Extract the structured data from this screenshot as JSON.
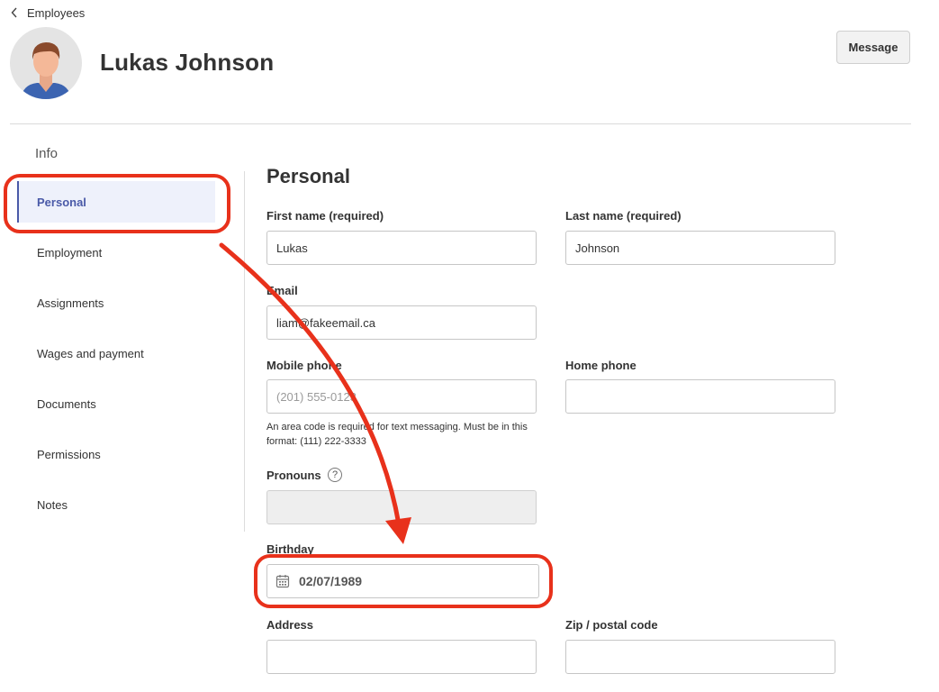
{
  "header": {
    "back_label": "Employees",
    "employee_name": "Lukas Johnson",
    "message_button": "Message"
  },
  "sidebar": {
    "heading": "Info",
    "items": [
      {
        "label": "Personal",
        "active": true
      },
      {
        "label": "Employment"
      },
      {
        "label": "Assignments"
      },
      {
        "label": "Wages and payment"
      },
      {
        "label": "Documents"
      },
      {
        "label": "Permissions"
      },
      {
        "label": "Notes"
      }
    ]
  },
  "form": {
    "section_title": "Personal",
    "first_name": {
      "label": "First name (required)",
      "value": "Lukas"
    },
    "last_name": {
      "label": "Last name (required)",
      "value": "Johnson"
    },
    "email": {
      "label": "Email",
      "value": "liam@fakeemail.ca"
    },
    "mobile_phone": {
      "label": "Mobile phone",
      "placeholder": "(201) 555-0123",
      "helper": "An area code is required for text messaging. Must be in this format: (111) 222-3333"
    },
    "home_phone": {
      "label": "Home phone",
      "value": ""
    },
    "pronouns": {
      "label": "Pronouns",
      "help_glyph": "?",
      "value": ""
    },
    "birthday": {
      "label": "Birthday",
      "value": "02/07/1989"
    },
    "address": {
      "label": "Address",
      "value": ""
    },
    "zip": {
      "label": "Zip / postal code",
      "value": ""
    }
  },
  "icons": [
    "chevron-left-icon",
    "calendar-icon",
    "help-circle-icon",
    "avatar-person-icon"
  ],
  "colors": {
    "accent": "#4a5aa8",
    "active_bg": "#eef1fb",
    "annotation": "#e8311b"
  }
}
